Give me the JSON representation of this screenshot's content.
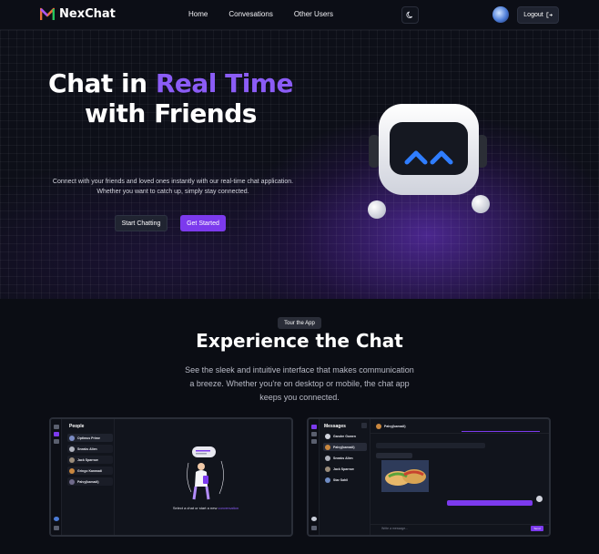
{
  "nav": {
    "brand": "NexChat",
    "links": [
      "Home",
      "Convesations",
      "Other Users"
    ],
    "theme_icon": "moon-icon",
    "logout_label": "Logout"
  },
  "hero": {
    "title_line1_plain": "Chat in ",
    "title_line1_accent": "Real Time",
    "title_line2": "with Friends",
    "subtitle": "Connect with your friends and loved ones instantly with our real-time chat application. Whether you want to catch up, simply stay connected.",
    "btn_chatting": "Start Chatting",
    "btn_started": "Get Started"
  },
  "tour": {
    "badge": "Tour the App",
    "title": "Experience the Chat",
    "subtitle": "See the sleek and intuitive interface that makes communication a breeze. Whether you're on desktop or mobile, the chat app keeps you connected."
  },
  "preview_people": {
    "title": "People",
    "users": [
      "Optimus Prime",
      "Sneaks Alien",
      "Jack Sparrow",
      "Gringo Kanmadi",
      "Palvy(kamadi)"
    ],
    "empty_plain": "Select a chat or start a new ",
    "empty_accent": "conversation"
  },
  "preview_messages": {
    "title": "Messages",
    "threads": [
      "Gandre Gowen",
      "Palvy(kamadi)",
      "Sneaks Alien",
      "Jack Sparrow",
      "Star Sahil"
    ],
    "chat_header": "Palvy(kamadi)",
    "input_placeholder": "Write a message...",
    "send_label": "Send"
  },
  "colors": {
    "accent": "#7c3aed",
    "accent_text": "#8b5cf6",
    "background": "#0b0d14"
  }
}
